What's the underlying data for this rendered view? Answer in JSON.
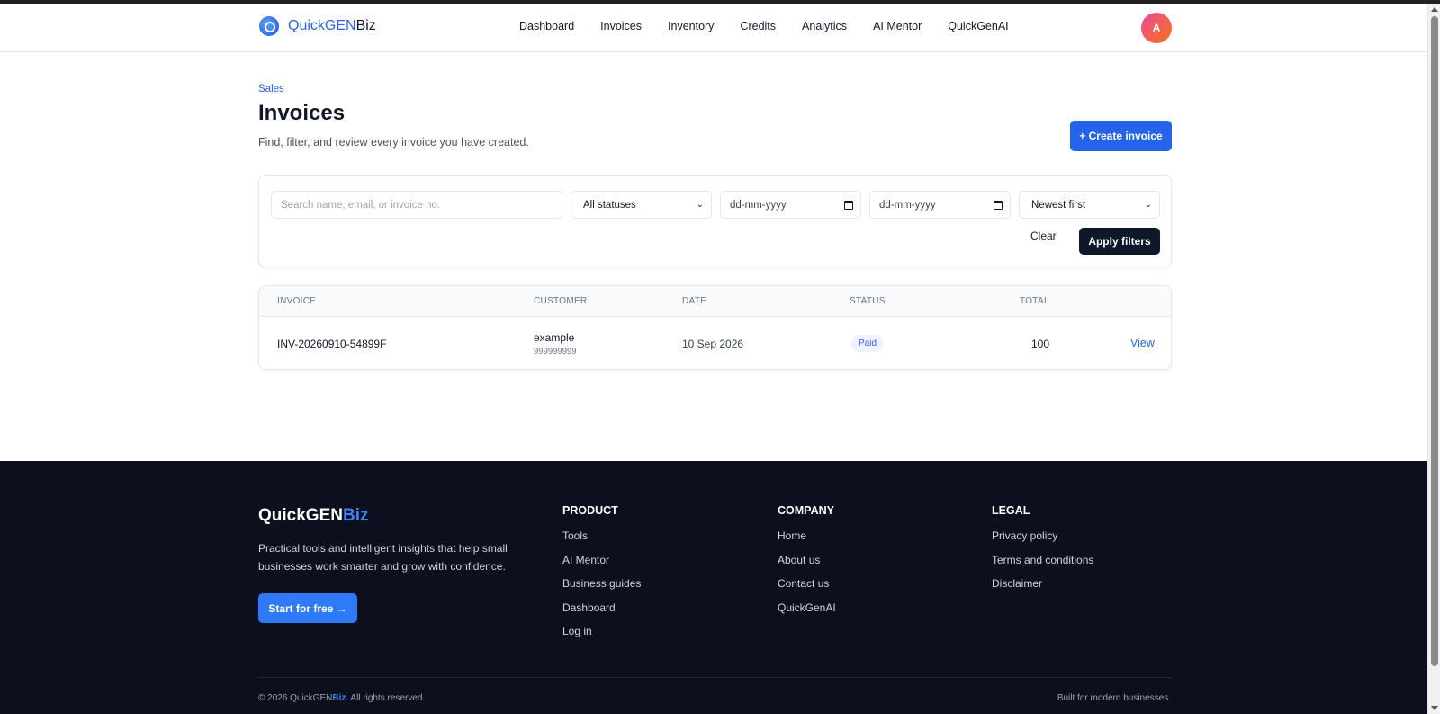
{
  "header": {
    "brand_part1": "QuickGEN",
    "brand_part2": "Biz",
    "nav": [
      "Dashboard",
      "Invoices",
      "Inventory",
      "Credits",
      "Analytics",
      "AI Mentor",
      "QuickGenAI"
    ],
    "avatar_initial": "A"
  },
  "page": {
    "breadcrumb": "Sales",
    "title": "Invoices",
    "subtitle": "Find, filter, and review every invoice you have created.",
    "create_label": "+ Create invoice"
  },
  "filters": {
    "search_placeholder": "Search name, email, or invoice no.",
    "status_value": "All statuses",
    "from_date_placeholder": "dd-mm-yyyy",
    "to_date_placeholder": "dd-mm-yyyy",
    "sort_value": "Newest first",
    "clear_label": "Clear",
    "apply_label": "Apply filters"
  },
  "table": {
    "columns": [
      "INVOICE",
      "CUSTOMER",
      "DATE",
      "STATUS",
      "TOTAL"
    ],
    "rows": [
      {
        "invoice": "INV-20260910-54899F",
        "customer_name": "example",
        "customer_phone": "999999999",
        "date": "10 Sep 2026",
        "status": "Paid",
        "total": "100",
        "action": "View"
      }
    ]
  },
  "footer": {
    "brand_part1": "QuickGEN",
    "brand_part2": "Biz",
    "description": "Practical tools and intelligent insights that help small businesses work smarter and grow with confidence.",
    "cta_label": "Start for free →",
    "product": {
      "heading": "PRODUCT",
      "links": [
        "Tools",
        "AI Mentor",
        "Business guides",
        "Dashboard",
        "Log in"
      ]
    },
    "company": {
      "heading": "COMPANY",
      "links": [
        "Home",
        "About us",
        "Contact us",
        "QuickGenAI"
      ]
    },
    "legal": {
      "heading": "LEGAL",
      "links": [
        "Privacy policy",
        "Terms and conditions",
        "Disclaimer"
      ]
    },
    "copyright_prefix": "© 2026 QuickGEN",
    "copyright_brand": "Biz.",
    "copyright_suffix": " All rights reserved.",
    "tagline": "Built for modern businesses."
  },
  "colors": {
    "accent": "#2563eb",
    "footer_bg": "#0b0f1e",
    "apply_bg": "#0f172a"
  }
}
